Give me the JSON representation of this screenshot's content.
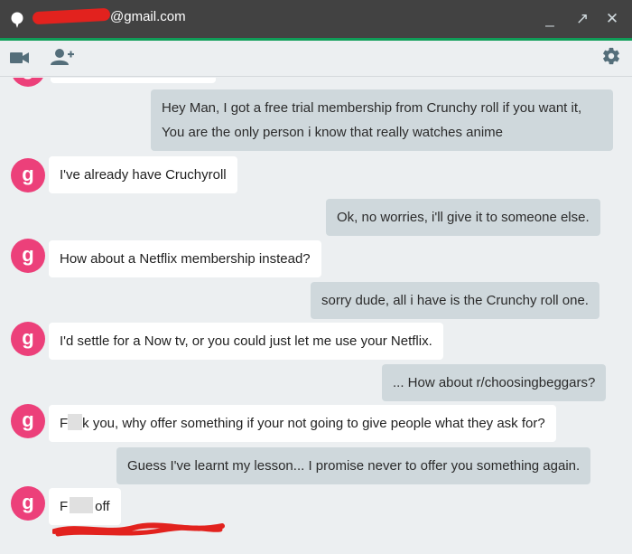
{
  "window": {
    "title_suffix": "@gmail.com",
    "minimize_label": "_",
    "popout_label": "↗",
    "close_label": "✕"
  },
  "toolbar": {
    "video_icon": "video-camera-icon",
    "add_person_icon": "add-person-icon",
    "settings_icon": "gear-icon"
  },
  "colors": {
    "titlebar": "#424242",
    "accent_green": "#0f9d58",
    "avatar": "#ec407a",
    "outgoing_bubble": "#cfd8dc",
    "incoming_bubble": "#ffffff",
    "redaction": "#e2221e"
  },
  "avatar_letter": "g",
  "messages": [
    {
      "from": "me",
      "lines": [
        "Hey Man, I got a free trial membership from Crunchy roll if you want it,",
        "You are the only person i know that really watches anime"
      ]
    },
    {
      "from": "them",
      "text": "I've already have Cruchyroll"
    },
    {
      "from": "me",
      "text": "Ok, no worries, i'll give it to someone else."
    },
    {
      "from": "them",
      "text": "How about a Netflix membership instead?"
    },
    {
      "from": "me",
      "text": "sorry dude, all i have is the Crunchy roll one."
    },
    {
      "from": "them",
      "text": "I'd settle for a Now tv, or you could just let me use your Netflix."
    },
    {
      "from": "me",
      "text": "... How about r/choosingbeggars?"
    },
    {
      "from": "them",
      "text_start": "F",
      "text_end": "k you, why offer something if your not going to give people what they ask for?"
    },
    {
      "from": "me",
      "text": "Guess I've learnt my lesson... I promise never to offer you something again."
    },
    {
      "from": "them",
      "text_start": "F",
      "text_end": "off"
    }
  ]
}
